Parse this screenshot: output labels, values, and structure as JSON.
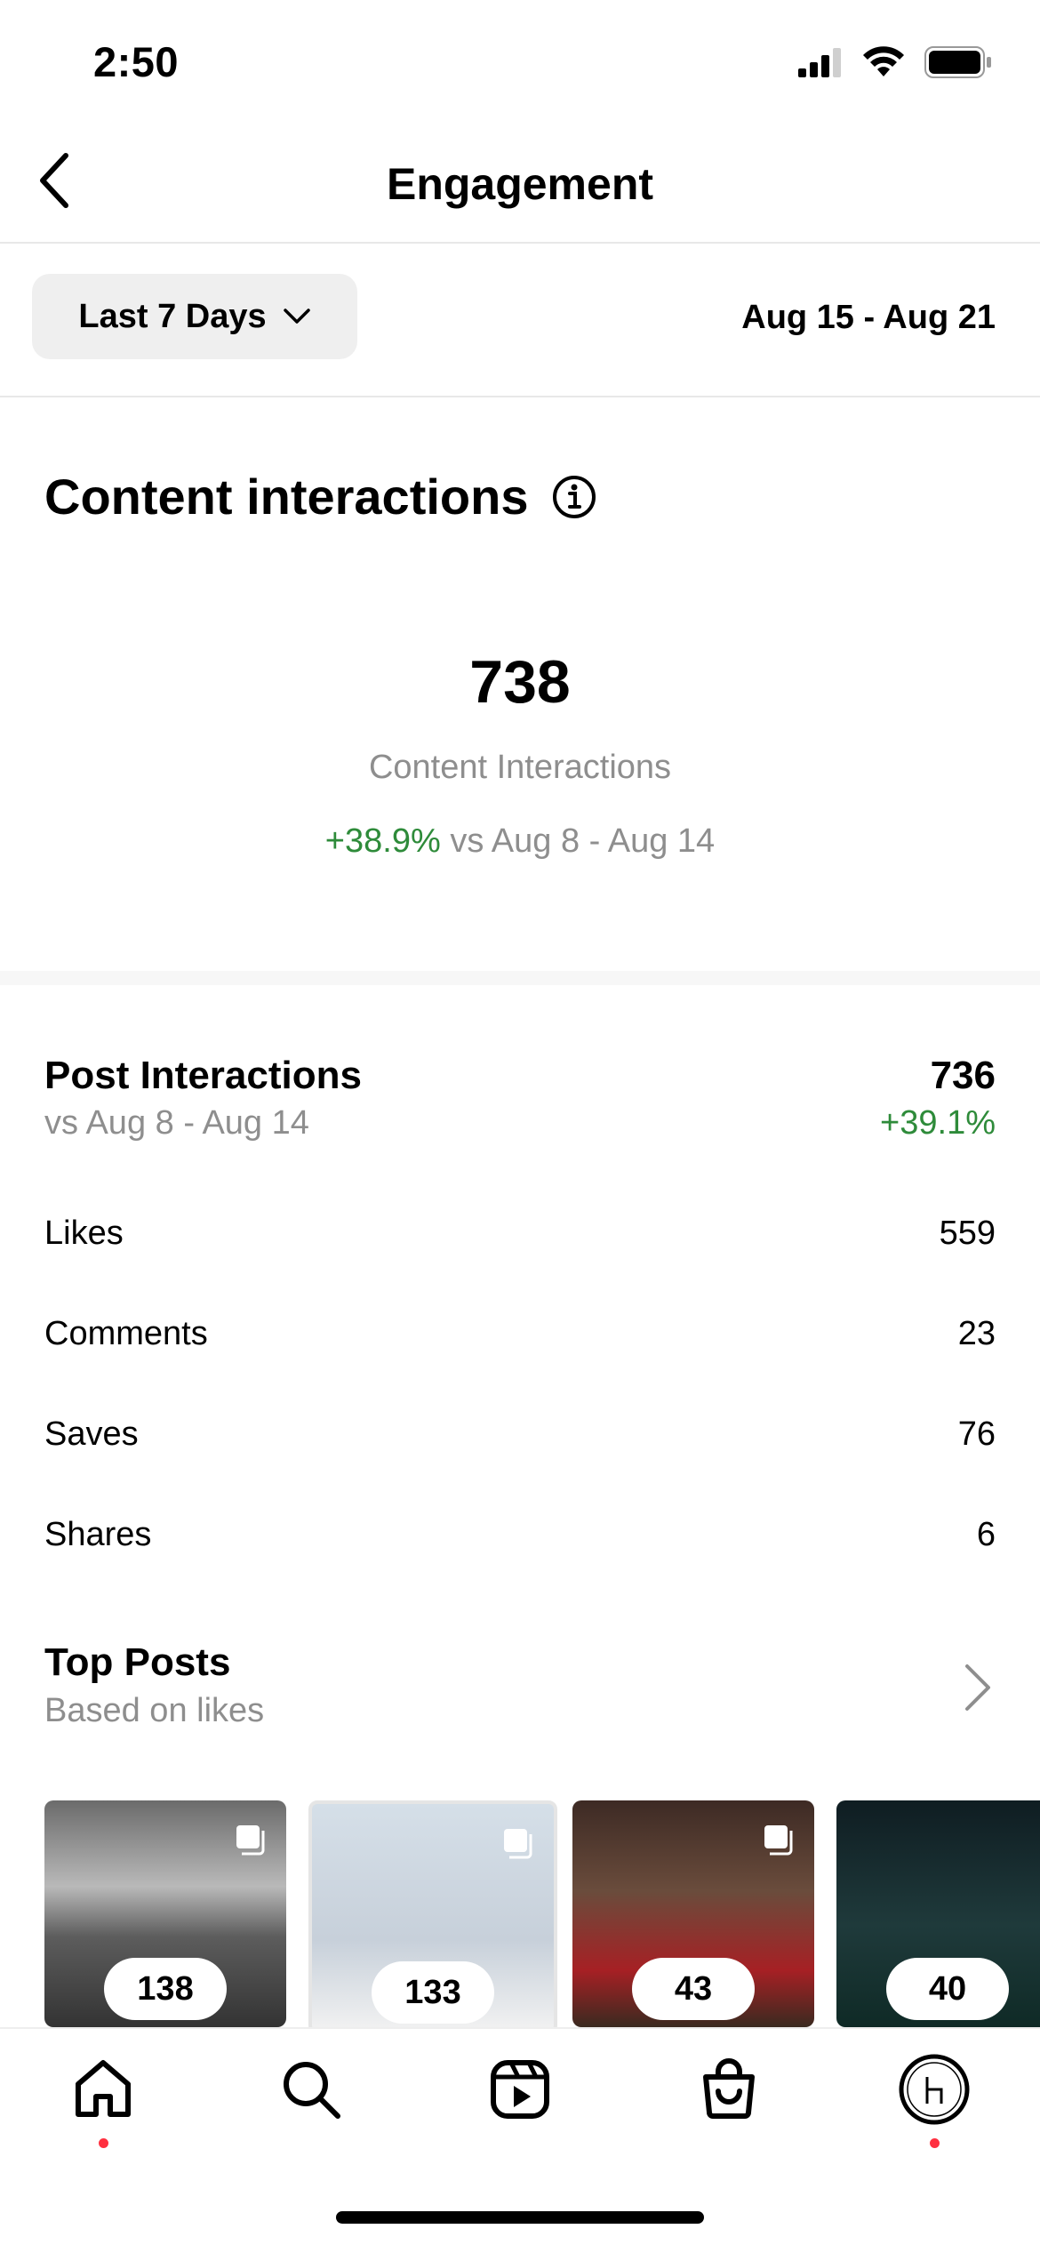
{
  "status_bar": {
    "time": "2:50"
  },
  "header": {
    "title": "Engagement"
  },
  "filter": {
    "range_label": "Last 7 Days",
    "date_range": "Aug 15 - Aug 21"
  },
  "content_interactions": {
    "title": "Content interactions",
    "total": "738",
    "label": "Content Interactions",
    "change": "+38.9%",
    "compare_text": "vs Aug 8 - Aug 14"
  },
  "post_interactions": {
    "title": "Post Interactions",
    "subtitle": "vs Aug 8 - Aug 14",
    "total": "736",
    "change": "+39.1%",
    "metrics": [
      {
        "label": "Likes",
        "value": "559"
      },
      {
        "label": "Comments",
        "value": "23"
      },
      {
        "label": "Saves",
        "value": "76"
      },
      {
        "label": "Shares",
        "value": "6"
      }
    ]
  },
  "top_posts": {
    "title": "Top Posts",
    "subtitle": "Based on likes",
    "posts": [
      {
        "count": "138",
        "image": "white-luxury-car"
      },
      {
        "count": "133",
        "image": "silver-supercar-magazine"
      },
      {
        "count": "43",
        "image": "bulls-basketball-player"
      },
      {
        "count": "40",
        "image": "green-sports-car"
      }
    ]
  },
  "nav": {
    "items": [
      "home-icon",
      "search-icon",
      "reels-icon",
      "shop-icon",
      "profile-avatar"
    ]
  },
  "colors": {
    "positive": "#2e8b3a",
    "notification_dot": "#ff3040",
    "muted_text": "#8e8e8e"
  }
}
